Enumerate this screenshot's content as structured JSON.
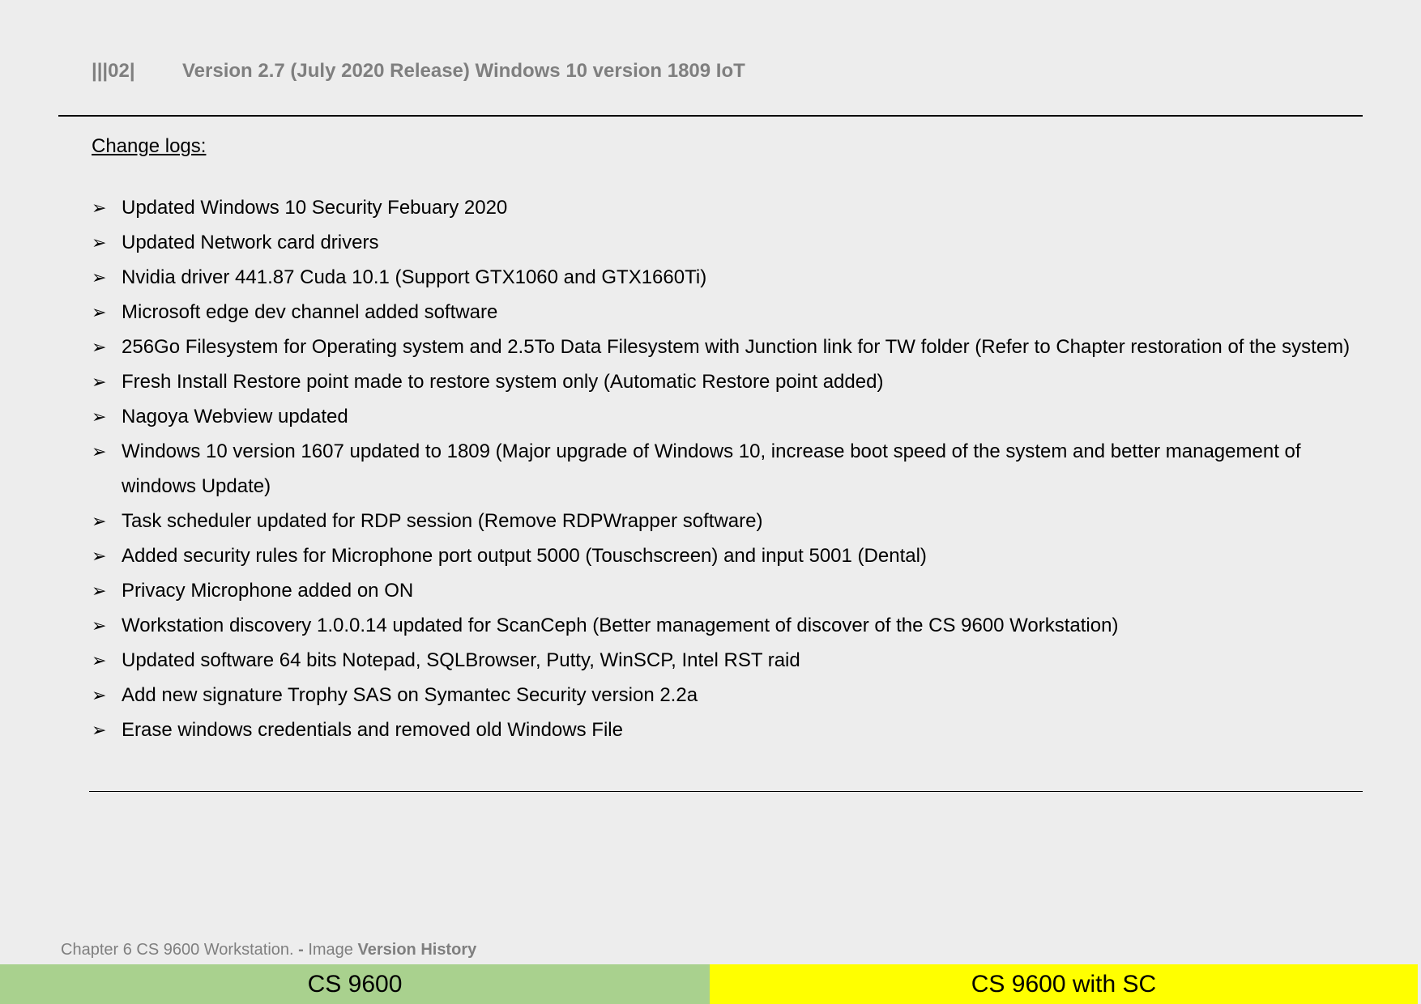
{
  "header": {
    "code": "|||02|",
    "title": "Version 2.7 (July 2020 Release) Windows 10 version 1809 IoT"
  },
  "section_title": "Change logs:",
  "bullet_glyph": "➢",
  "changelog": [
    "Updated Windows 10 Security Febuary 2020",
    "Updated Network card drivers",
    "Nvidia driver 441.87 Cuda 10.1 (Support GTX1060 and GTX1660Ti)",
    "Microsoft edge dev channel added software",
    "256Go Filesystem for Operating system and 2.5To Data Filesystem with Junction link for TW folder (Refer to Chapter restoration of the system)",
    "Fresh Install Restore point made to restore system only (Automatic Restore point added)",
    "Nagoya Webview updated",
    "Windows 10 version 1607 updated to 1809 (Major upgrade of Windows 10, increase boot speed of the system and better management of windows Update)",
    "Task scheduler updated for RDP session (Remove RDPWrapper software)",
    "Added security rules for Microphone port output 5000 (Touschscreen) and input 5001 (Dental)",
    "Privacy Microphone added on ON",
    "Workstation discovery 1.0.0.14 updated for ScanCeph (Better management of discover of the CS 9600 Workstation)",
    "Updated software 64 bits Notepad, SQLBrowser, Putty, WinSCP, Intel RST raid",
    "Add new signature Trophy SAS on Symantec Security version 2.2a",
    "Erase windows credentials and removed old Windows File"
  ],
  "footer": {
    "chapter": "Chapter 6 CS 9600 Workstation.",
    "separator": " - ",
    "image_label": "Image ",
    "section": "Version History"
  },
  "tabs": {
    "left": "CS 9600",
    "right": "CS 9600 with SC"
  },
  "colors": {
    "left_tab": "#a9d18e",
    "right_tab": "#ffff00",
    "header_text": "#7f7f7f"
  }
}
